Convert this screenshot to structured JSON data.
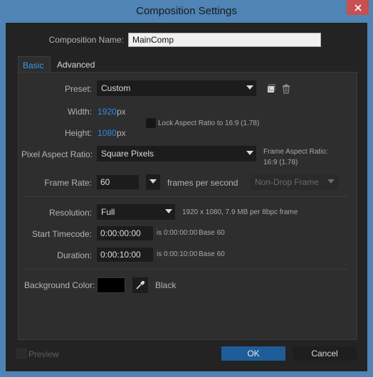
{
  "window": {
    "title": "Composition Settings"
  },
  "composition": {
    "name_label": "Composition Name:",
    "name_value": "MainComp"
  },
  "tabs": [
    {
      "label": "Basic"
    },
    {
      "label": "Advanced"
    }
  ],
  "basic": {
    "preset_label": "Preset:",
    "preset_value": "Custom",
    "width_label": "Width:",
    "width_value": "1920",
    "width_unit": "px",
    "height_label": "Height:",
    "height_value": "1080",
    "height_unit": "px",
    "lock_aspect_label": "Lock Aspect Ratio to 16:9 (1.78)",
    "lock_aspect_checked": false,
    "par_label": "Pixel Aspect Ratio:",
    "par_value": "Square Pixels",
    "frame_aspect_label": "Frame Aspect Ratio:",
    "frame_aspect_value": "16:9 (1.78)",
    "frame_rate_label": "Frame Rate:",
    "frame_rate_value": "60",
    "frame_rate_unit": "frames per second",
    "drop_frame_value": "Non-Drop Frame",
    "resolution_label": "Resolution:",
    "resolution_value": "Full",
    "resolution_info": "1920 x 1080, 7.9 MB per 8bpc frame",
    "start_tc_label": "Start Timecode:",
    "start_tc_value": "0:00:00:00",
    "start_tc_info": "is 0:00:00:00",
    "start_tc_base": "Base 60",
    "duration_label": "Duration:",
    "duration_value": "0:00:10:00",
    "duration_info": "is 0:00:10:00",
    "duration_base": "Base 60",
    "bg_label": "Background Color:",
    "bg_color": "#000000",
    "bg_color_name": "Black"
  },
  "footer": {
    "preview_label": "Preview",
    "ok_label": "OK",
    "cancel_label": "Cancel"
  },
  "colors": {
    "accent": "#2d8ceb",
    "ok_button": "#1f5c9a",
    "close_button": "#c75050",
    "title_bar": "#4f84b4"
  },
  "icons": {
    "save_preset": "save-preset-icon",
    "delete_preset": "trash-icon",
    "eyedropper": "eyedropper-icon",
    "close": "close-icon"
  }
}
